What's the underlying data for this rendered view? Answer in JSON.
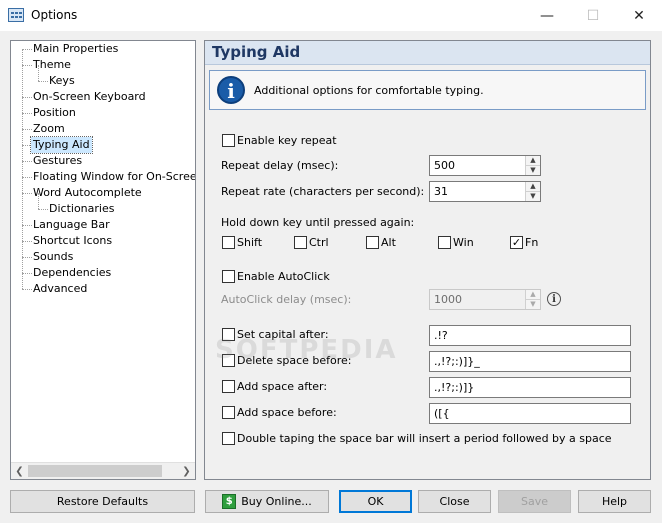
{
  "window": {
    "title": "Options",
    "minimize": "—",
    "maximize": "☐",
    "close": "✕"
  },
  "tree": {
    "items": [
      {
        "label": "Main Properties",
        "level": 0
      },
      {
        "label": "Theme",
        "level": 0
      },
      {
        "label": "Keys",
        "level": 1
      },
      {
        "label": "On-Screen Keyboard",
        "level": 0
      },
      {
        "label": "Position",
        "level": 0
      },
      {
        "label": "Zoom",
        "level": 0
      },
      {
        "label": "Typing Aid",
        "level": 0,
        "selected": true
      },
      {
        "label": "Gestures",
        "level": 0
      },
      {
        "label": "Floating Window for On-Screen Ke",
        "level": 0
      },
      {
        "label": "Word Autocomplete",
        "level": 0
      },
      {
        "label": "Dictionaries",
        "level": 1
      },
      {
        "label": "Language Bar",
        "level": 0
      },
      {
        "label": "Shortcut Icons",
        "level": 0
      },
      {
        "label": "Sounds",
        "level": 0
      },
      {
        "label": "Dependencies",
        "level": 0
      },
      {
        "label": "Advanced",
        "level": 0
      }
    ],
    "scroll_left": "❮",
    "scroll_right": "❯"
  },
  "panel": {
    "title": "Typing Aid",
    "info_icon": "i",
    "info_text": "Additional options for comfortable typing.",
    "enable_key_repeat": {
      "label": "Enable key repeat",
      "checked": false
    },
    "repeat_delay": {
      "label": "Repeat delay (msec):",
      "value": "500"
    },
    "repeat_rate": {
      "label": "Repeat rate (characters per second):",
      "value": "31"
    },
    "hold_down_label": "Hold down key until pressed again:",
    "modifiers": [
      {
        "label": "Shift",
        "checked": false
      },
      {
        "label": "Ctrl",
        "checked": false
      },
      {
        "label": "Alt",
        "checked": false
      },
      {
        "label": "Win",
        "checked": false
      },
      {
        "label": "Fn",
        "checked": true
      }
    ],
    "enable_autoclick": {
      "label": "Enable AutoClick",
      "checked": false
    },
    "autoclick_delay": {
      "label": "AutoClick delay (msec):",
      "value": "1000"
    },
    "help_icon": "i",
    "set_capital_after": {
      "label": "Set capital after:",
      "value": ".!?",
      "checked": false
    },
    "delete_space_before": {
      "label": "Delete space before:",
      "value": ".,!?;:)]}_",
      "checked": false
    },
    "add_space_after": {
      "label": "Add space after:",
      "value": ".,!?;:)]}",
      "checked": false
    },
    "add_space_before": {
      "label": "Add space before:",
      "value": "([{",
      "checked": false
    },
    "double_tap": {
      "label": "Double taping the space bar will insert a period followed by a space",
      "checked": false
    },
    "spin_up": "▲",
    "spin_down": "▼",
    "check_mark": "✓",
    "watermark": "SOFTPEDIA"
  },
  "buttons": {
    "restore_defaults": "Restore Defaults",
    "buy_online": "Buy Online...",
    "buy_icon": "$",
    "ok": "OK",
    "close": "Close",
    "save": "Save",
    "help": "Help"
  }
}
